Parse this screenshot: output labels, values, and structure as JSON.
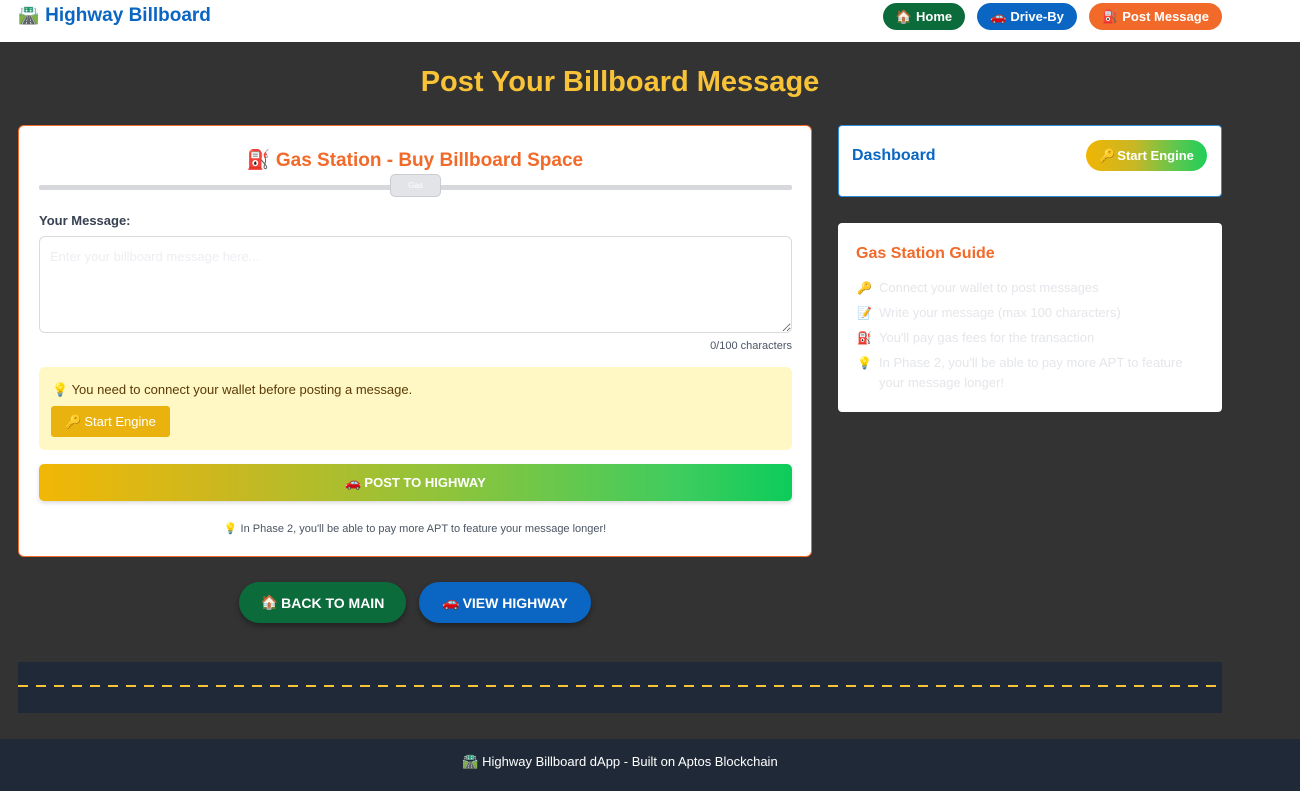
{
  "header": {
    "brand": {
      "icon": "🛣️",
      "icon_name": "highway-icon",
      "label": "Highway Billboard"
    },
    "nav": [
      {
        "icon": "🏠",
        "icon_name": "house-icon",
        "label": "Home"
      },
      {
        "icon": "🚗",
        "icon_name": "car-icon",
        "label": "Drive-By"
      },
      {
        "icon": "⛽",
        "icon_name": "fuel-pump-icon",
        "label": "Post Message"
      }
    ]
  },
  "page_title": "Post Your Billboard Message",
  "gas_station": {
    "title_icon": "⛽",
    "title": "Gas Station - Buy Billboard Space",
    "slider_thumb_label": "Gas",
    "message_label": "Your Message:",
    "message_placeholder": "Enter your billboard message here...",
    "message_value": "",
    "char_count": "0/100 characters",
    "wallet_warning": {
      "icon": "💡",
      "text": "You need to connect your wallet before posting a message."
    },
    "start_engine_button": {
      "icon": "🔑",
      "label": "Start Engine"
    },
    "post_button": {
      "icon": "🚗",
      "label": "POST TO HIGHWAY"
    },
    "phase_note": {
      "icon": "💡",
      "text": "In Phase 2, you'll be able to pay more APT to feature your message longer!"
    }
  },
  "dashboard": {
    "title": "Dashboard",
    "start_engine_button": {
      "icon": "🔑",
      "label": "Start Engine"
    }
  },
  "guide": {
    "title": "Gas Station Guide",
    "items": [
      {
        "icon": "🔑",
        "text": "Connect your wallet to post messages"
      },
      {
        "icon": "📝",
        "text": "Write your message (max 100 characters)"
      },
      {
        "icon": "⛽",
        "text": "You'll pay gas fees for the transaction"
      },
      {
        "icon": "💡",
        "text": "In Phase 2, you'll be able to pay more APT to feature your message longer!"
      }
    ]
  },
  "actions": {
    "back": {
      "icon": "🏠",
      "label": "BACK TO MAIN"
    },
    "view": {
      "icon": "🚗",
      "label": "VIEW HIGHWAY"
    }
  },
  "footer": {
    "icon": "🛣️",
    "text": "Highway Billboard dApp - Built on Aptos Blockchain"
  },
  "colors": {
    "background": "#333333",
    "brand_blue": "#0a66c2",
    "accent_orange": "#f26a2a",
    "title_yellow": "#f8c337",
    "home_green": "#0b6b3a",
    "warning_bg": "#fff7c4",
    "road": "#1f2937"
  }
}
